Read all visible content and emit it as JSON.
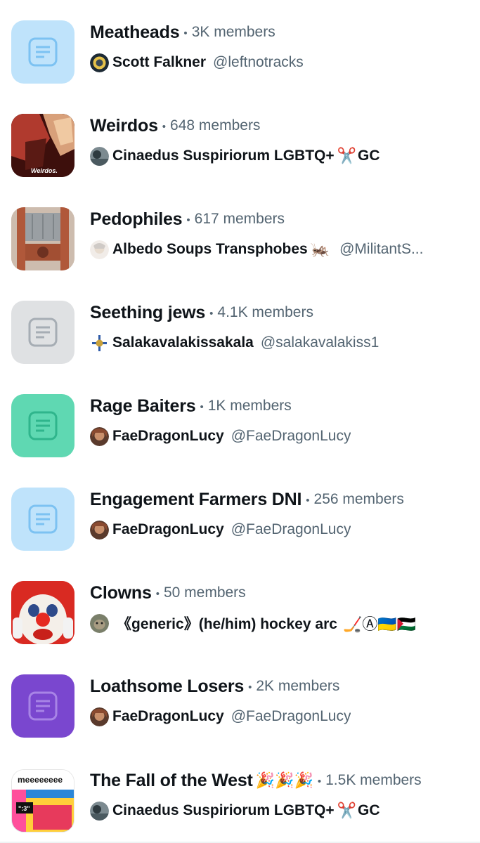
{
  "colors": {
    "light_blue": "#bfe3fb",
    "light_blue_icon": "#7cc2f2",
    "gray": "#dfe1e3",
    "gray_icon": "#a6adb4",
    "mint": "#5fd8b2",
    "mint_icon": "#2fb58c",
    "purple": "#7a47cf",
    "purple_icon": "#a884e6",
    "secondary_text": "#536471"
  },
  "communities": [
    {
      "name": "Meatheads",
      "members": "3K members",
      "thumb": "light-blue-placeholder",
      "owner_name": "Scott Falkner",
      "owner_handle": "@leftnotracks",
      "owner_decor": ""
    },
    {
      "name": "Weirdos",
      "members": "648 members",
      "thumb": "weirdos-photo",
      "thumb_caption": "Weirdos.",
      "owner_name": "Cinaedus Suspiriorum LGBTQ+",
      "owner_decor": "✂️",
      "owner_suffix": "GC",
      "owner_handle": ""
    },
    {
      "name": "Pedophiles",
      "members": "617 members",
      "thumb": "guillotine-image",
      "owner_name": "Albedo Soups Transphobes",
      "owner_decor": "🦗",
      "owner_handle": "@MilitantS..."
    },
    {
      "name": "Seething jews",
      "members": "4.1K members",
      "thumb": "gray-placeholder",
      "owner_name": "Salakavalakissakala",
      "owner_handle": "@salakavalakiss1",
      "owner_decor": ""
    },
    {
      "name": "Rage Baiters",
      "members": "1K members",
      "thumb": "mint-placeholder",
      "owner_name": "FaeDragonLucy",
      "owner_handle": "@FaeDragonLucy",
      "owner_decor": ""
    },
    {
      "name": "Engagement Farmers DNI",
      "members": "256 members",
      "thumb": "light-blue-placeholder",
      "owner_name": "FaeDragonLucy",
      "owner_handle": "@FaeDragonLucy",
      "owner_decor": ""
    },
    {
      "name": "Clowns",
      "members": "50 members",
      "thumb": "clown-photo",
      "owner_name": "《generic》(he/him) hockey arc",
      "owner_decor": "🏒Ⓐ🇺🇦🇵🇸",
      "owner_handle": ""
    },
    {
      "name": "Loathsome Losers",
      "members": "2K members",
      "thumb": "purple-placeholder",
      "owner_name": "FaeDragonLucy",
      "owner_handle": "@FaeDragonLucy",
      "owner_decor": ""
    },
    {
      "name": "The Fall of the West",
      "name_decor": "🎉🎉🎉",
      "members": "1.5K members",
      "thumb": "meme-image",
      "thumb_caption": "meeeeeeee",
      "thumb_caption2": "\":3\"",
      "owner_name": "Cinaedus Suspiriorum LGBTQ+",
      "owner_decor": "✂️",
      "owner_suffix": "GC",
      "owner_handle": ""
    }
  ]
}
